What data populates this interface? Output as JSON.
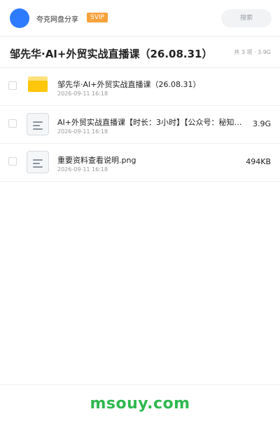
{
  "header": {
    "site_name": "夸克网盘分享",
    "badge": "SVIP",
    "search_placeholder": "搜索"
  },
  "folder": {
    "title": "邹先华·AI+外贸实战直播课（26.08.31）",
    "summary": "共 3 项 · 3.9G"
  },
  "files": [
    {
      "name": "邹先华·AI+外贸实战直播课（26.08.31）",
      "date": "2026-09-11 16:18",
      "size": "",
      "type": "folder-icon"
    },
    {
      "name": "AI+外贸实战直播课【时长：3小时】【公众号：秘知…",
      "date": "2026-09-11 16:18",
      "size": "3.9G",
      "type": "document-icon"
    },
    {
      "name": "重要资料查看说明.png",
      "date": "2026-09-11 16:18",
      "size": "494KB",
      "type": "document-icon"
    }
  ],
  "watermark": "msouy.com",
  "colors": {
    "accent": "#2f7bff",
    "svip": "#f7a23b",
    "folder": "#ffc60a",
    "watermark": "#2fb84f"
  }
}
